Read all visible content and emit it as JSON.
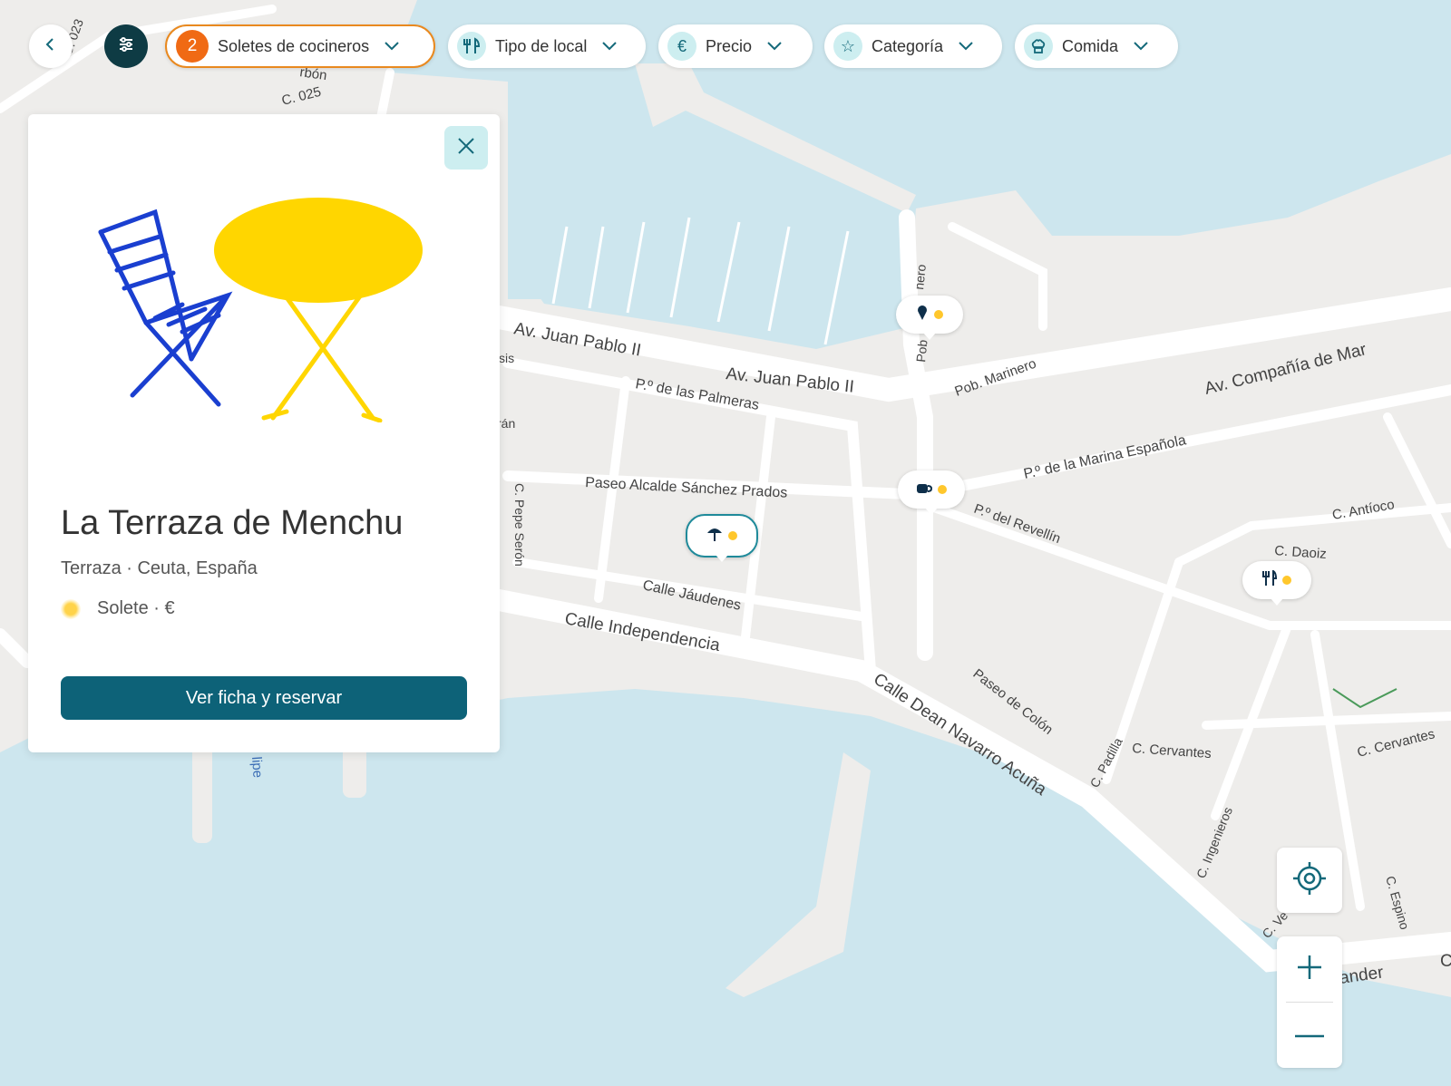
{
  "toolbar": {
    "filter_count": "2",
    "chips": {
      "soletes": "Soletes de cocineros",
      "tipo": "Tipo de local",
      "precio": "Precio",
      "categoria": "Categoría",
      "comida": "Comida"
    },
    "icons": {
      "back": "chevron-left-icon",
      "filters": "sliders-icon",
      "tipo": "cutlery-icon",
      "precio": "euro-icon",
      "categoria": "star-icon",
      "comida": "chef-hat-icon"
    }
  },
  "card": {
    "title": "La Terraza de Menchu",
    "subtitle": "Terraza · Ceuta, España",
    "rating": "Solete · €",
    "button": "Ver ficha y reservar"
  },
  "map": {
    "streets": [
      "Av. Juan Pablo II",
      "Av. Juan Pablo II",
      "Av. Compañía de Mar",
      "P.º de las Palmeras",
      "Pob. Marinero",
      "P.º de la Marina Española",
      "Paseo Alcalde Sánchez Prados",
      "P.º del Revellín",
      "C. Antíoco",
      "C. Daoiz",
      "Calle Jáudenes",
      "Calle Independencia",
      "Calle Dean Navarro Acuña",
      "Paseo de Colón",
      "C. Padilla",
      "C. Cervantes",
      "C. Cervantes",
      "C. Ingenieros",
      "C. Espino",
      "C. Pepe Serón",
      "C. 025",
      "C. 023",
      "rbón",
      "nero",
      "Pob",
      "ander",
      "C. Ve",
      "lipe",
      "sis",
      "rán",
      "C"
    ]
  },
  "colors": {
    "water": "#cde6ee",
    "land": "#eeedeb",
    "accent": "#0d6278",
    "orange": "#f06a14",
    "sun": "#ffc72c"
  }
}
